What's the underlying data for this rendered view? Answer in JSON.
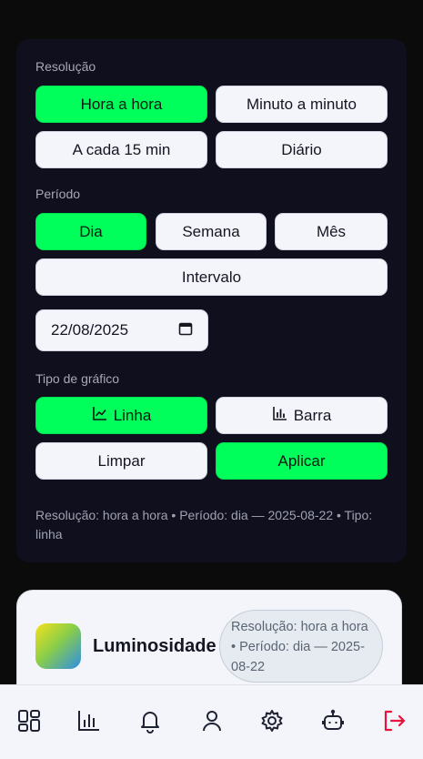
{
  "filters": {
    "resolution_label": "Resolução",
    "resolution_options": [
      "Hora a hora",
      "Minuto a minuto",
      "A cada 15 min",
      "Diário"
    ],
    "period_label": "Período",
    "period_options": [
      "Dia",
      "Semana",
      "Mês",
      "Intervalo"
    ],
    "date_value": "22/08/2025",
    "chart_type_label": "Tipo de gráfico",
    "chart_type_options": [
      "Linha",
      "Barra"
    ],
    "clear_label": "Limpar",
    "apply_label": "Aplicar",
    "summary": "Resolução: hora a hora • Período: dia — 2025-08-22 • Tipo: linha"
  },
  "card": {
    "title": "Luminosidade",
    "badge": "Resolução: hora a hora • Período: dia — 2025-08-22"
  },
  "bottom_nav": {
    "items": [
      "dashboard-icon",
      "chart-icon",
      "bell-icon",
      "user-icon",
      "gear-icon",
      "robot-icon",
      "logout-icon"
    ]
  },
  "colors": {
    "accent": "#00ff5a",
    "panel_bg": "#0f0f1e",
    "logout": "#e8123a"
  }
}
